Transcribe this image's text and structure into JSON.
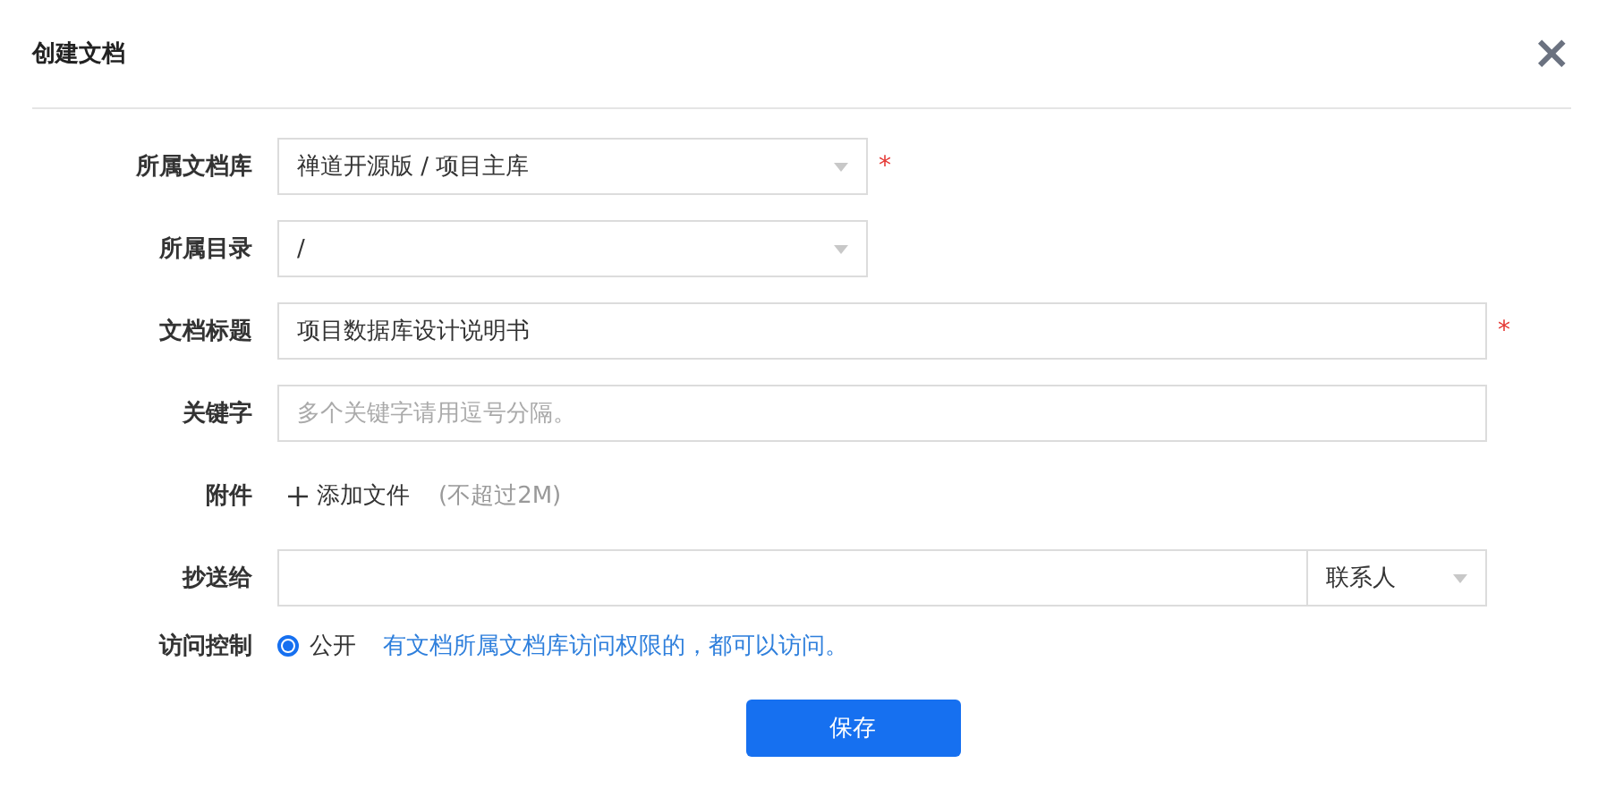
{
  "dialog": {
    "title": "创建文档",
    "close": "×"
  },
  "fields": [
    {
      "kind": "select",
      "label": "所属文档库",
      "value": "禅道开源版 / 项目主库",
      "required_mark": "*"
    },
    {
      "kind": "select",
      "label": "所属目录",
      "value": "/"
    },
    {
      "kind": "text",
      "label": "文档标题",
      "value": "项目数据库设计说明书",
      "required_mark": "*"
    },
    {
      "kind": "text",
      "label": "关键字",
      "placeholder": "多个关键字请用逗号分隔。"
    },
    {
      "kind": "attachment",
      "label": "附件",
      "action": "添加文件",
      "hint": "(不超过2M)"
    },
    {
      "kind": "cc",
      "label": "抄送给",
      "addon": "联系人"
    },
    {
      "kind": "radio",
      "label": "访问控制",
      "options": [
        {
          "label": "公开",
          "selected": true
        }
      ],
      "note": "有文档所属文档库访问权限的，都可以访问。"
    }
  ],
  "save": "保存"
}
